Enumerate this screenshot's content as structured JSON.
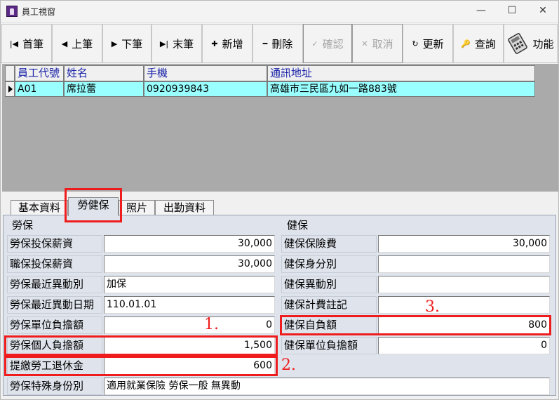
{
  "window": {
    "title": "員工視窗",
    "controls": {
      "minimize": "—",
      "maximize": "☐",
      "close": "✕"
    }
  },
  "toolbar": {
    "buttons": [
      {
        "label": "首筆",
        "icon": "|◀"
      },
      {
        "label": "上筆",
        "icon": "◀"
      },
      {
        "label": "下筆",
        "icon": "▶"
      },
      {
        "label": "末筆",
        "icon": "▶|"
      },
      {
        "label": "新增",
        "icon": "✚"
      },
      {
        "label": "刪除",
        "icon": "━"
      },
      {
        "label": "確認",
        "icon": "✓",
        "disabled": true
      },
      {
        "label": "取消",
        "icon": "✕",
        "disabled": true
      },
      {
        "label": "更新",
        "icon": "↻"
      },
      {
        "label": "查詢",
        "icon": "🔑"
      },
      {
        "label": "功能",
        "icon": "calculator-icon"
      }
    ]
  },
  "grid": {
    "columns": [
      "員工代號",
      "姓名",
      "手機",
      "通訊地址"
    ],
    "rows": [
      {
        "id": "A01",
        "name": "席拉蕾",
        "phone": "0920939843",
        "address": "高雄市三民區九如一路883號"
      }
    ]
  },
  "tabs": [
    "基本資料",
    "勞健保",
    "照片",
    "出勤資料"
  ],
  "selected_tab": "勞健保",
  "labor": {
    "title": "勞保",
    "fields": [
      {
        "label": "勞保投保薪資",
        "value": "30,000"
      },
      {
        "label": "職保投保薪資",
        "value": "30,000"
      },
      {
        "label": "勞保最近異動別",
        "value": "加保"
      },
      {
        "label": "勞保最近異動日期",
        "value": "110.01.01"
      },
      {
        "label": "勞保單位負擔額",
        "value": "0"
      },
      {
        "label": "勞保個人負擔額",
        "value": "1,500"
      },
      {
        "label": "提繳勞工退休金",
        "value": "600"
      },
      {
        "label": "勞保特殊身份別",
        "value": "適用就業保險  勞保一般  無異動"
      }
    ]
  },
  "health": {
    "title": "健保",
    "fields": [
      {
        "label": "健保保險費",
        "value": "30,000"
      },
      {
        "label": "健保身分別",
        "value": ""
      },
      {
        "label": "健保異動別",
        "value": ""
      },
      {
        "label": "健保計費註記",
        "value": ""
      },
      {
        "label": "健保自負額",
        "value": "800"
      },
      {
        "label": "健保單位負擔額",
        "value": "0"
      }
    ]
  },
  "annotations": {
    "a1": "1.",
    "a2": "2.",
    "a3": "3.",
    "color": "#ee1c1c"
  }
}
